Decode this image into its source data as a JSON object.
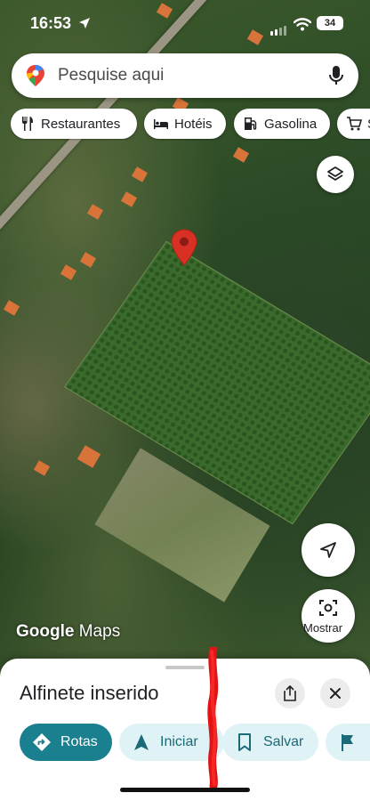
{
  "status_bar": {
    "time": "16:53",
    "battery": "34"
  },
  "search": {
    "placeholder": "Pesquise aqui"
  },
  "chips": [
    {
      "label": "Restaurantes",
      "icon": "fork-knife-icon"
    },
    {
      "label": "Hotéis",
      "icon": "bed-icon"
    },
    {
      "label": "Gasolina",
      "icon": "gas-pump-icon"
    },
    {
      "label": "S",
      "icon": "cart-icon"
    }
  ],
  "map": {
    "logo_google": "Google",
    "logo_maps": "Maps",
    "show_button_label": "Mostrar",
    "marker_color": "#d93025"
  },
  "sheet": {
    "title": "Alfinete inserido",
    "actions": [
      {
        "label": "Rotas",
        "icon": "directions-icon"
      },
      {
        "label": "Iniciar",
        "icon": "navigation-arrow-icon"
      },
      {
        "label": "Salvar",
        "icon": "bookmark-icon"
      },
      {
        "label": "",
        "icon": "flag-icon"
      }
    ]
  },
  "colors": {
    "accent": "#1a7f8e",
    "chip_light": "#dff2f6",
    "annotation": "#e01414"
  }
}
